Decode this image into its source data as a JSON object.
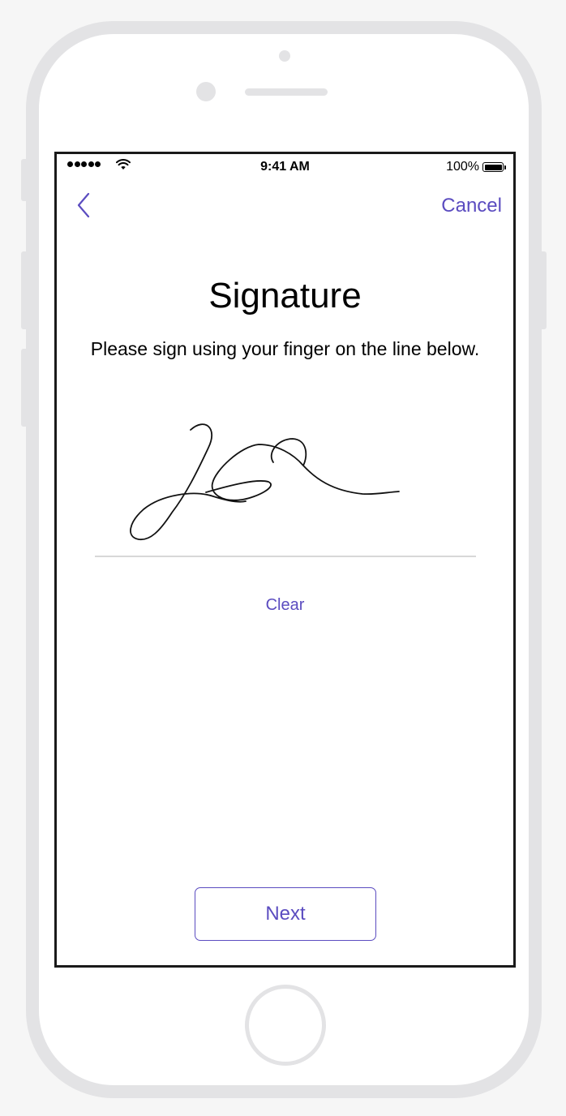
{
  "status_bar": {
    "time": "9:41 AM",
    "battery_percent": "100%",
    "signal_bars": 5,
    "icons": [
      "signal-dots-icon",
      "wifi-icon",
      "battery-icon"
    ]
  },
  "nav": {
    "back_icon": "chevron-left-icon",
    "cancel_label": "Cancel"
  },
  "content": {
    "title": "Signature",
    "instructions": "Please sign using your finger on the line below.",
    "clear_label": "Clear",
    "next_label": "Next"
  },
  "colors": {
    "accent": "#5b4cc0",
    "device_frame": "#e3e3e5",
    "background": "#f6f6f6",
    "signature_line": "#d8d8d8"
  }
}
